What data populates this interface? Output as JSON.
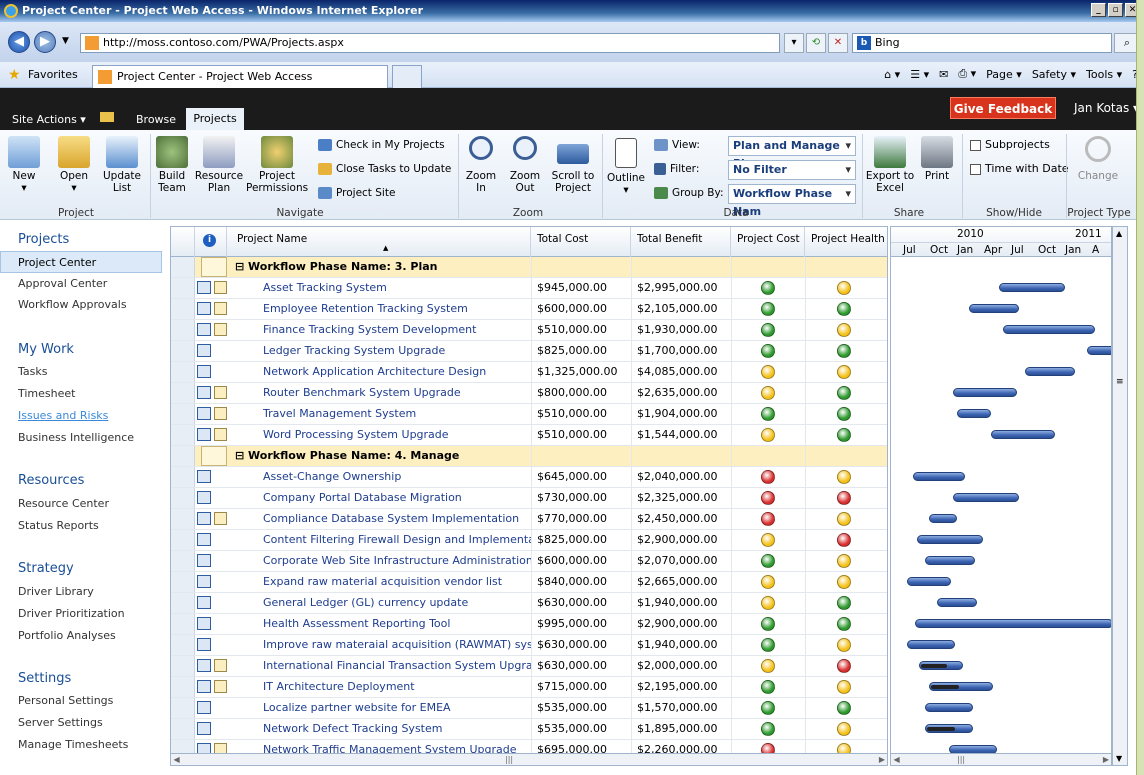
{
  "window": {
    "title": "Project Center - Project Web Access - Windows Internet Explorer"
  },
  "browser": {
    "address": "http://moss.contoso.com/PWA/Projects.aspx",
    "search_placeholder": "Bing",
    "favorites_label": "Favorites",
    "tab_title": "Project Center - Project Web Access",
    "commands": [
      "Page ▾",
      "Safety ▾",
      "Tools ▾"
    ]
  },
  "sp": {
    "site_actions": "Site Actions ▾",
    "browse": "Browse",
    "projects_tab": "Projects",
    "feedback": "Give Feedback",
    "user": "Jan Kotas ▾"
  },
  "ribbon": {
    "project": {
      "new": "New",
      "open": "Open",
      "update": "Update",
      "update2": "List",
      "label": "Project"
    },
    "navigate": {
      "build": "Build",
      "build2": "Team",
      "resource": "Resource",
      "resource2": "Plan",
      "perms": "Project",
      "perms2": "Permissions",
      "checkin": "Check in My Projects",
      "close": "Close Tasks to Update",
      "site": "Project Site",
      "label": "Navigate"
    },
    "zoom": {
      "in": "Zoom",
      "in2": "In",
      "out": "Zoom",
      "out2": "Out",
      "scroll": "Scroll to",
      "scroll2": "Project",
      "label": "Zoom"
    },
    "data": {
      "outline": "Outline",
      "view_label": "View:",
      "filter_label": "Filter:",
      "group_label": "Group By:",
      "view": "Plan and Manage Ph",
      "filter": "No Filter",
      "group": "Workflow Phase Nam",
      "label": "Data"
    },
    "share": {
      "export": "Export to",
      "export2": "Excel",
      "print": "Print",
      "label": "Share"
    },
    "showhide": {
      "sub": "Subprojects",
      "timedate": "Time with Date",
      "label": "Show/Hide"
    },
    "ptype": {
      "change": "Change",
      "label": "Project Type"
    }
  },
  "nav": {
    "projects": "Projects",
    "project_center": "Project Center",
    "approval_center": "Approval Center",
    "workflow_approvals": "Workflow Approvals",
    "my_work": "My Work",
    "tasks": "Tasks",
    "timesheet": "Timesheet",
    "issues": "Issues and Risks",
    "bi": "Business Intelligence",
    "resources": "Resources",
    "resource_center": "Resource Center",
    "status_reports": "Status Reports",
    "strategy": "Strategy",
    "driver_library": "Driver Library",
    "driver_prior": "Driver Prioritization",
    "portfolio": "Portfolio Analyses",
    "settings": "Settings",
    "personal": "Personal Settings",
    "server": "Server Settings",
    "manage_ts": "Manage Timesheets"
  },
  "grid": {
    "headers": {
      "name": "Project Name",
      "cost": "Total Cost",
      "benefit": "Total Benefit",
      "pcost": "Project Cost",
      "phealth": "Project Health"
    },
    "rows": [
      {
        "group": "⊟ Workflow Phase Name: 3. Plan"
      },
      {
        "name": "Asset Tracking System",
        "cost": "$945,000.00",
        "benefit": "$2,995,000.00",
        "c": "green",
        "h": "yellow",
        "plan": true
      },
      {
        "name": "Employee Retention Tracking System",
        "cost": "$600,000.00",
        "benefit": "$2,105,000.00",
        "c": "green",
        "h": "green",
        "plan": true
      },
      {
        "name": "Finance Tracking System Development",
        "cost": "$510,000.00",
        "benefit": "$1,930,000.00",
        "c": "green",
        "h": "yellow",
        "plan": true
      },
      {
        "name": "Ledger Tracking System Upgrade",
        "cost": "$825,000.00",
        "benefit": "$1,700,000.00",
        "c": "green",
        "h": "green",
        "plan": false
      },
      {
        "name": "Network Application Architecture Design",
        "cost": "$1,325,000.00",
        "benefit": "$4,085,000.00",
        "c": "yellow",
        "h": "yellow",
        "plan": false
      },
      {
        "name": "Router Benchmark System Upgrade",
        "cost": "$800,000.00",
        "benefit": "$2,635,000.00",
        "c": "yellow",
        "h": "green",
        "plan": true
      },
      {
        "name": "Travel Management System",
        "cost": "$510,000.00",
        "benefit": "$1,904,000.00",
        "c": "green",
        "h": "green",
        "plan": true
      },
      {
        "name": "Word Processing System Upgrade",
        "cost": "$510,000.00",
        "benefit": "$1,544,000.00",
        "c": "yellow",
        "h": "green",
        "plan": true
      },
      {
        "group": "⊟ Workflow Phase Name: 4. Manage"
      },
      {
        "name": "Asset-Change Ownership",
        "cost": "$645,000.00",
        "benefit": "$2,040,000.00",
        "c": "red",
        "h": "yellow",
        "plan": false
      },
      {
        "name": "Company Portal Database Migration",
        "cost": "$730,000.00",
        "benefit": "$2,325,000.00",
        "c": "red",
        "h": "red",
        "plan": false
      },
      {
        "name": "Compliance Database System Implementation",
        "cost": "$770,000.00",
        "benefit": "$2,450,000.00",
        "c": "red",
        "h": "yellow",
        "plan": true
      },
      {
        "name": "Content Filtering Firewall Design and Implementation",
        "cost": "$825,000.00",
        "benefit": "$2,900,000.00",
        "c": "yellow",
        "h": "red",
        "plan": false
      },
      {
        "name": "Corporate Web Site Infrastructure Administration",
        "cost": "$600,000.00",
        "benefit": "$2,070,000.00",
        "c": "green",
        "h": "yellow",
        "plan": false
      },
      {
        "name": "Expand raw material acquisition vendor list",
        "cost": "$840,000.00",
        "benefit": "$2,665,000.00",
        "c": "yellow",
        "h": "yellow",
        "plan": false
      },
      {
        "name": "General Ledger (GL) currency update",
        "cost": "$630,000.00",
        "benefit": "$1,940,000.00",
        "c": "yellow",
        "h": "green",
        "plan": false
      },
      {
        "name": "Health Assessment Reporting Tool",
        "cost": "$995,000.00",
        "benefit": "$2,900,000.00",
        "c": "green",
        "h": "green",
        "plan": false
      },
      {
        "name": "Improve raw materaial acquisition (RAWMAT) system",
        "cost": "$630,000.00",
        "benefit": "$1,940,000.00",
        "c": "green",
        "h": "yellow",
        "plan": false
      },
      {
        "name": "International Financial Transaction System Upgrade",
        "cost": "$630,000.00",
        "benefit": "$2,000,000.00",
        "c": "yellow",
        "h": "red",
        "plan": true
      },
      {
        "name": "IT Architecture Deployment",
        "cost": "$715,000.00",
        "benefit": "$2,195,000.00",
        "c": "green",
        "h": "yellow",
        "plan": true
      },
      {
        "name": "Localize partner website for EMEA",
        "cost": "$535,000.00",
        "benefit": "$1,570,000.00",
        "c": "green",
        "h": "green",
        "plan": false
      },
      {
        "name": "Network Defect Tracking System",
        "cost": "$535,000.00",
        "benefit": "$1,895,000.00",
        "c": "green",
        "h": "yellow",
        "plan": false
      },
      {
        "name": "Network Traffic Management System Upgrade",
        "cost": "$695,000.00",
        "benefit": "$2,260,000.00",
        "c": "red",
        "h": "yellow",
        "plan": true
      }
    ]
  },
  "gantt": {
    "year1": "2010",
    "year2": "2011",
    "months": [
      "Jul",
      "Oct",
      "Jan",
      "Apr",
      "Jul",
      "Oct",
      "Jan",
      "A"
    ]
  },
  "colors": {
    "green": "#2e9a2e",
    "yellow": "#f5c21b",
    "red": "#d83030",
    "link": "#1e3d8f"
  }
}
